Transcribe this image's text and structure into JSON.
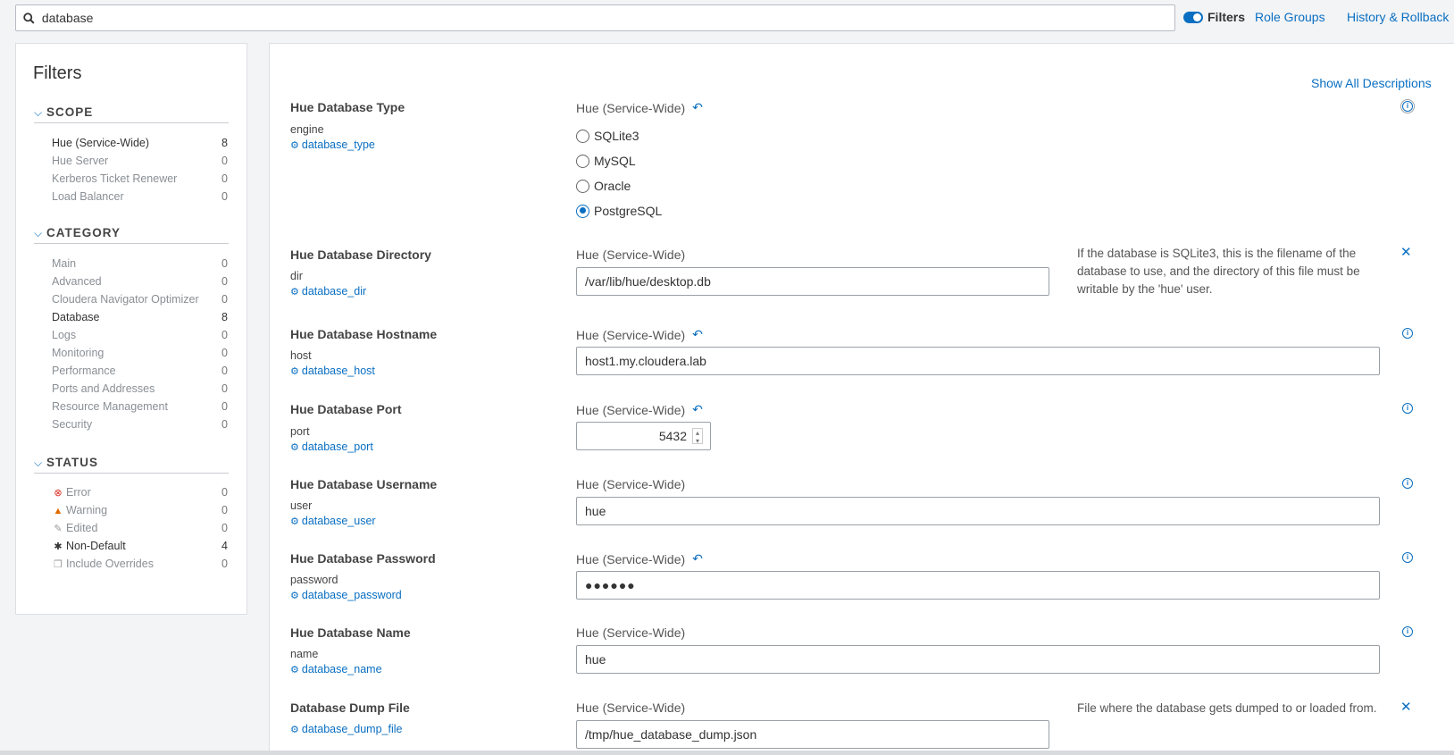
{
  "search": {
    "value": "database"
  },
  "top": {
    "filters_label": "Filters",
    "role_groups": "Role Groups",
    "history": "History & Rollback"
  },
  "filters": {
    "title": "Filters",
    "scope": {
      "label": "SCOPE",
      "items": [
        {
          "label": "Hue (Service-Wide)",
          "count": "8"
        },
        {
          "label": "Hue Server",
          "count": "0"
        },
        {
          "label": "Kerberos Ticket Renewer",
          "count": "0"
        },
        {
          "label": "Load Balancer",
          "count": "0"
        }
      ]
    },
    "category": {
      "label": "CATEGORY",
      "items": [
        {
          "label": "Main",
          "count": "0"
        },
        {
          "label": "Advanced",
          "count": "0"
        },
        {
          "label": "Cloudera Navigator Optimizer",
          "count": "0"
        },
        {
          "label": "Database",
          "count": "8"
        },
        {
          "label": "Logs",
          "count": "0"
        },
        {
          "label": "Monitoring",
          "count": "0"
        },
        {
          "label": "Performance",
          "count": "0"
        },
        {
          "label": "Ports and Addresses",
          "count": "0"
        },
        {
          "label": "Resource Management",
          "count": "0"
        },
        {
          "label": "Security",
          "count": "0"
        }
      ]
    },
    "status": {
      "label": "STATUS",
      "items": [
        {
          "label": "Error",
          "count": "0",
          "icon": "error-icon"
        },
        {
          "label": "Warning",
          "count": "0",
          "icon": "warning-icon"
        },
        {
          "label": "Edited",
          "count": "0",
          "icon": "edit-icon"
        },
        {
          "label": "Non-Default",
          "count": "4",
          "icon": "asterisk-icon"
        },
        {
          "label": "Include Overrides",
          "count": "0",
          "icon": "copy-icon"
        }
      ]
    }
  },
  "main": {
    "show_all": "Show All Descriptions",
    "params": [
      {
        "title": "Hue Database Type",
        "key": "engine",
        "name": "database_type",
        "scope": "Hue (Service-Wide)",
        "options": [
          "SQLite3",
          "MySQL",
          "Oracle",
          "PostgreSQL"
        ],
        "selected": "PostgreSQL"
      },
      {
        "title": "Hue Database Directory",
        "key": "dir",
        "name": "database_dir",
        "scope": "Hue (Service-Wide)",
        "value": "/var/lib/hue/desktop.db",
        "description": "If the database is SQLite3, this is the filename of the database to use, and the directory of this file must be writable by the 'hue' user."
      },
      {
        "title": "Hue Database Hostname",
        "key": "host",
        "name": "database_host",
        "scope": "Hue (Service-Wide)",
        "value": "host1.my.cloudera.lab"
      },
      {
        "title": "Hue Database Port",
        "key": "port",
        "name": "database_port",
        "scope": "Hue (Service-Wide)",
        "value": "5432"
      },
      {
        "title": "Hue Database Username",
        "key": "user",
        "name": "database_user",
        "scope": "Hue (Service-Wide)",
        "value": "hue"
      },
      {
        "title": "Hue Database Password",
        "key": "password",
        "name": "database_password",
        "scope": "Hue (Service-Wide)",
        "value": "●●●●●●"
      },
      {
        "title": "Hue Database Name",
        "key": "name",
        "name": "database_name",
        "scope": "Hue (Service-Wide)",
        "value": "hue"
      },
      {
        "title": "Database Dump File",
        "name": "database_dump_file",
        "scope": "Hue (Service-Wide)",
        "value": "/tmp/hue_database_dump.json",
        "description": "File where the database gets dumped to or loaded from."
      }
    ]
  }
}
